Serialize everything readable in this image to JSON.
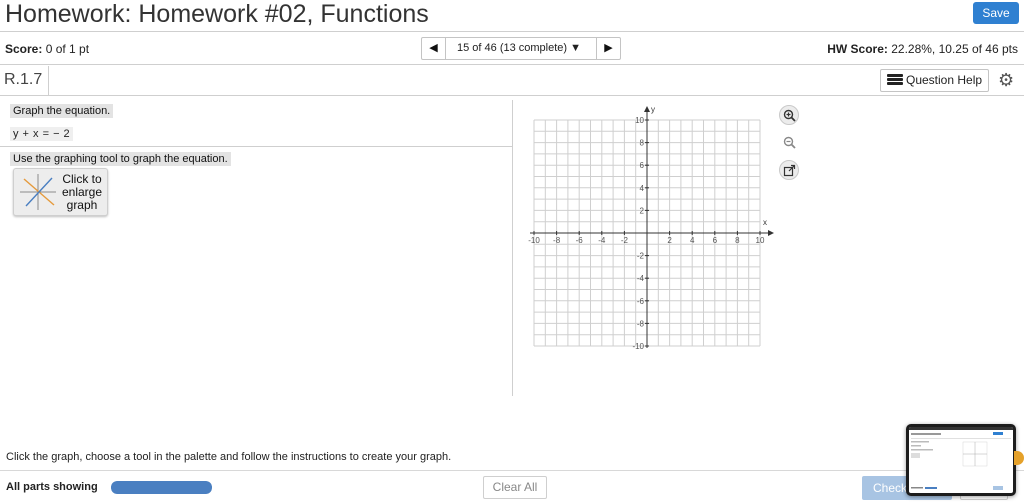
{
  "header": {
    "title": "Homework: Homework #02, Functions",
    "save_label": "Save"
  },
  "score_bar": {
    "score_label": "Score:",
    "score_value": "0 of 1 pt",
    "nav_label": "15 of 46 (13 complete)",
    "hw_score_label": "HW Score:",
    "hw_score_value": "22.28%, 10.25 of 46 pts"
  },
  "section": {
    "id": "R.1.7",
    "question_help_label": "Question Help"
  },
  "question": {
    "prompt": "Graph the equation.",
    "equation": "y + x = − 2",
    "tool_instruction": "Use the graphing tool to graph the equation.",
    "enlarge_label": "Click to enlarge graph"
  },
  "graph": {
    "x_axis_label": "x",
    "y_axis_label": "y",
    "x_range": [
      -10,
      10
    ],
    "y_range": [
      -10,
      10
    ],
    "x_tick_labels": [
      "-10",
      "-8",
      "-6",
      "-4",
      "-2",
      "2",
      "4",
      "6",
      "8",
      "10"
    ],
    "y_tick_labels": [
      "10",
      "8",
      "6",
      "4",
      "2",
      "-2",
      "-4",
      "-6",
      "-8",
      "-10"
    ],
    "grid": true,
    "tools": [
      {
        "name": "zoom-in-icon"
      },
      {
        "name": "zoom-out-icon"
      },
      {
        "name": "popout-icon"
      }
    ]
  },
  "footer": {
    "instruction": "Click the graph, choose a tool in the palette and follow the instructions to create your graph.",
    "parts_label": "All parts showing",
    "progress_fraction": 1.0,
    "clear_all_label": "Clear All",
    "check_label": "Check"
  },
  "colors": {
    "accent": "#2f80d1",
    "progress": "#4a7fc1",
    "check_disabled": "#a8c4e3"
  }
}
